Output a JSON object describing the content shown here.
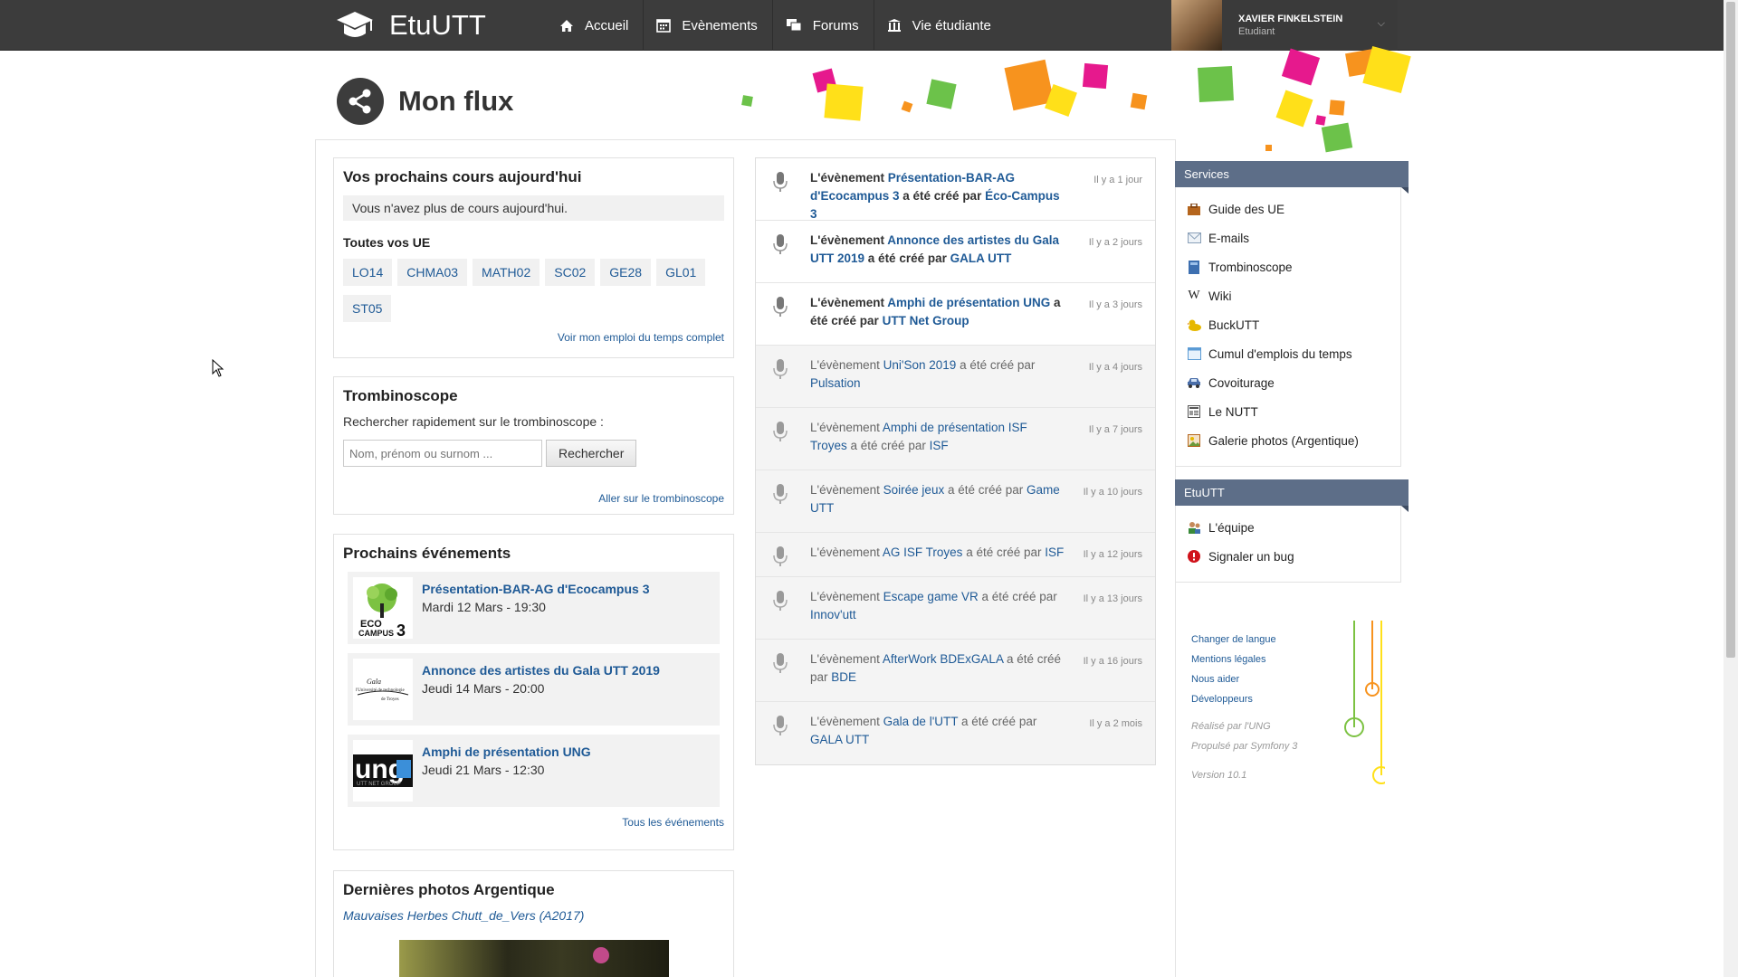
{
  "topbar": {
    "brand": "EtuUTT",
    "nav": [
      {
        "label": "Accueil",
        "icon": "home-icon"
      },
      {
        "label": "Evènements",
        "icon": "calendar-icon"
      },
      {
        "label": "Forums",
        "icon": "forum-icon"
      },
      {
        "label": "Vie étudiante",
        "icon": "building-icon"
      }
    ],
    "user": {
      "name": "XAVIER FINKELSTEIN",
      "role": "Etudiant"
    }
  },
  "page": {
    "title": "Mon flux"
  },
  "courses": {
    "title": "Vos prochains cours aujourd'hui",
    "empty_message": "Vous n'avez plus de cours aujourd'hui.",
    "ue_heading": "Toutes vos UE",
    "ues": [
      "LO14",
      "CHMA03",
      "MATH02",
      "SC02",
      "GE28",
      "GL01",
      "ST05"
    ],
    "link": "Voir mon emploi du temps complet"
  },
  "trombi": {
    "title": "Trombinoscope",
    "label": "Rechercher rapidement sur le trombinoscope :",
    "placeholder": "Nom, prénom ou surnom ...",
    "button": "Rechercher",
    "link": "Aller sur le trombinoscope"
  },
  "events": {
    "title": "Prochains événements",
    "items": [
      {
        "title": "Présentation-BAR-AG d'Ecocampus 3",
        "date": "Mardi 12 Mars - 19:30",
        "logo_text": "ECO CAMPUS 3"
      },
      {
        "title": "Annonce des artistes du Gala UTT 2019",
        "date": "Jeudi 14 Mars - 20:00",
        "logo_text": "Gala de l'Université de technologie de Troyes"
      },
      {
        "title": "Amphi de présentation UNG",
        "date": "Jeudi 21 Mars - 12:30",
        "logo_text": "ung"
      }
    ],
    "link": "Tous les événements"
  },
  "photos": {
    "title": "Dernières photos Argentique",
    "album": "Mauvaises Herbes Chutt_de_Vers (A2017)"
  },
  "feed": {
    "prefix": "L'évènement",
    "middle": "a été créé par",
    "items": [
      {
        "event": "Présentation-BAR-AG d'Ecocampus 3",
        "org": "Éco-Campus 3",
        "time": "Il y a 1 jour",
        "unread": true
      },
      {
        "event": "Annonce des artistes du Gala UTT 2019",
        "org": "GALA UTT",
        "time": "Il y a 2 jours",
        "unread": true
      },
      {
        "event": "Amphi de présentation UNG",
        "org": "UTT Net Group",
        "time": "Il y a 3 jours",
        "unread": true
      },
      {
        "event": "Uni'Son 2019",
        "org": "Pulsation",
        "time": "Il y a 4 jours",
        "unread": false
      },
      {
        "event": "Amphi de présentation ISF Troyes",
        "org": "ISF",
        "time": "Il y a 7 jours",
        "unread": false
      },
      {
        "event": "Soirée jeux",
        "org": "Game UTT",
        "time": "Il y a 10 jours",
        "unread": false
      },
      {
        "event": "AG ISF Troyes",
        "org": "ISF",
        "time": "Il y a 12 jours",
        "unread": false
      },
      {
        "event": "Escape game VR",
        "org": "Innov'utt",
        "time": "Il y a 13 jours",
        "unread": false
      },
      {
        "event": "AfterWork BDExGALA",
        "org": "BDE",
        "time": "Il y a 16 jours",
        "unread": false
      },
      {
        "event": "Gala de l'UTT",
        "org": "GALA UTT",
        "time": "Il y a 2 mois",
        "unread": false
      }
    ]
  },
  "sidebar": {
    "services_title": "Services",
    "services": [
      {
        "label": "Guide des UE",
        "icon": "briefcase-icon",
        "color": "#b5651d"
      },
      {
        "label": "E-mails",
        "icon": "mail-icon",
        "color": "#8aa0b8"
      },
      {
        "label": "Trombinoscope",
        "icon": "book-icon",
        "color": "#3d6fb0"
      },
      {
        "label": "Wiki",
        "icon": "wiki-icon",
        "color": "#222222"
      },
      {
        "label": "BuckUTT",
        "icon": "duck-icon",
        "color": "#e6b800"
      },
      {
        "label": "Cumul d'emplois du temps",
        "icon": "calendar-icon",
        "color": "#5b9bd5"
      },
      {
        "label": "Covoiturage",
        "icon": "car-icon",
        "color": "#4a6ea9"
      },
      {
        "label": "Le NUTT",
        "icon": "newspaper-icon",
        "color": "#555555"
      },
      {
        "label": "Galerie photos (Argentique)",
        "icon": "photo-icon",
        "color": "#b5651d"
      }
    ],
    "etuutt_title": "EtuUTT",
    "etuutt": [
      {
        "label": "L'équipe",
        "icon": "team-icon",
        "color": "#3a8a3a"
      },
      {
        "label": "Signaler un bug",
        "icon": "alert-icon",
        "color": "#d0121a"
      }
    ]
  },
  "footer": {
    "links": [
      "Changer de langue",
      "Mentions légales",
      "Nous aider",
      "Développeurs"
    ],
    "credits": [
      "Réalisé par l'UNG",
      "Propulsé par Symfony 3"
    ],
    "version": "Version 10.1"
  },
  "colors": {
    "topbar": "#3c3c3c",
    "link": "#1f5a96",
    "sidebar_head": "#5d6e88"
  }
}
